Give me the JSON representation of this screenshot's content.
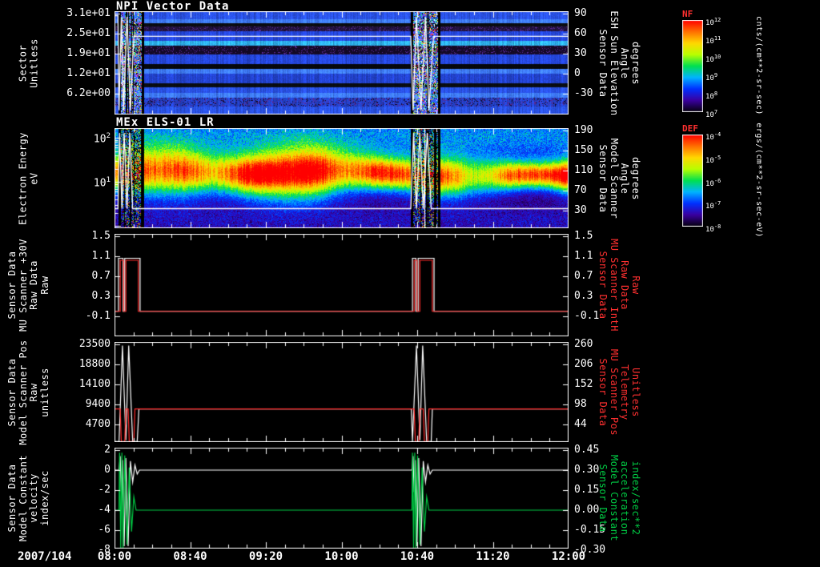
{
  "figure": {
    "background": "#000000",
    "date_label": "2007/104",
    "x_axis": {
      "tick_labels": [
        "08:00",
        "08:40",
        "09:20",
        "10:00",
        "10:40",
        "11:20",
        "12:00"
      ],
      "start_hour": 8.0,
      "end_hour": 12.0,
      "minor_tick_minutes": 10
    },
    "event_windows_hours": [
      [
        8.04,
        8.25
      ],
      [
        10.62,
        10.86
      ]
    ]
  },
  "colors": {
    "axis": "#ffffff",
    "red_series": "#ff2a2a",
    "green_series": "#00cc44",
    "white_series": "#ffffff",
    "colorbar_title": "#ff3030"
  },
  "chart_data": [
    {
      "type": "heatmap",
      "title": "NPI Vector Data",
      "left_axis": {
        "label_lines": [
          "Sector",
          "Unitless"
        ],
        "tick_labels": [
          "3.1e+01",
          "2.5e+01",
          "1.9e+01",
          "1.2e+01",
          "6.2e+00"
        ],
        "color": "#ffffff"
      },
      "right_axis": {
        "label_lines": [
          "Sensor Data",
          "ESH Sun Elevation",
          "Angle",
          "degrees"
        ],
        "tick_labels": [
          "90",
          "60",
          "30",
          "0",
          "-30"
        ],
        "top_tick_value": 90,
        "tick_step": -30,
        "color": "#ffffff"
      },
      "colorbar": {
        "title": "NF",
        "units": "cnts/(cm**2-sr-sec)",
        "tick_base": "10",
        "tick_exponents": [
          "12",
          "11",
          "10",
          "9",
          "8",
          "7"
        ]
      },
      "band_rows": [
        [
          10,
          "#2a52e8",
          0
        ],
        [
          5,
          "#3f7cff",
          0
        ],
        [
          4,
          "#0a0d12",
          0
        ],
        [
          6,
          "#241440",
          1
        ],
        [
          12,
          "#2547dd",
          0
        ],
        [
          6,
          "#2fb3f2",
          0
        ],
        [
          11,
          "#150a28",
          1
        ],
        [
          12,
          "#2547dd",
          0
        ],
        [
          6,
          "#06080c",
          0
        ],
        [
          6,
          "#3f7cff",
          0
        ],
        [
          12,
          "#2343cf",
          0
        ],
        [
          5,
          "#0a0d12",
          0
        ],
        [
          7,
          "#2a52e8",
          0
        ],
        [
          6,
          "#3f7cff",
          0
        ],
        [
          11,
          "#2343cf",
          1
        ],
        [
          10,
          "#2a52e8",
          0
        ]
      ],
      "noise_palette": [
        "#3355ff",
        "#22ccff",
        "#000000",
        "#ff3333",
        "#ffee00",
        "#33ff66",
        "#cc44ff",
        "#000000",
        "#3355ff",
        "#ffffff"
      ],
      "overlay_trace": {
        "name": "ESH Sun Elevation Angle",
        "color": "#ffffff",
        "axis": "right",
        "points": [
          [
            8.0,
            87
          ],
          [
            8.03,
            87
          ],
          [
            8.04,
            -55
          ],
          [
            8.06,
            85
          ],
          [
            8.08,
            -55
          ],
          [
            8.11,
            85
          ],
          [
            8.14,
            -55
          ],
          [
            8.17,
            56
          ],
          [
            10.61,
            56
          ],
          [
            10.63,
            -55
          ],
          [
            10.66,
            85
          ],
          [
            10.7,
            -55
          ],
          [
            10.74,
            85
          ],
          [
            10.77,
            -55
          ],
          [
            10.81,
            56
          ],
          [
            12.0,
            56
          ]
        ]
      }
    },
    {
      "type": "heatmap",
      "title": "MEx ELS-01 LR",
      "left_axis": {
        "label_lines": [
          "Electron Energy",
          "eV"
        ],
        "log": true,
        "decade_exponents": [
          "2",
          "1"
        ],
        "log_top": 2.217,
        "log_bottom": -0.046,
        "color": "#ffffff"
      },
      "right_axis": {
        "label_lines": [
          "Sensor Data",
          "Model Scanner",
          "Angle",
          "degrees"
        ],
        "tick_labels": [
          "190",
          "150",
          "110",
          "70",
          "30"
        ],
        "top_tick_value": 190,
        "tick_step": -40,
        "color": "#ffffff"
      },
      "colorbar": {
        "title": "DEF",
        "units": "ergs/(cm**2-sr-sec-eV)",
        "tick_base": "10",
        "tick_exponents": [
          "-4",
          "-5",
          "-6",
          "-7",
          "-8"
        ]
      },
      "spectrum": {
        "center_log_ev": 1.15,
        "sigma_log": 0.3,
        "peak_amp": 1.0,
        "haze_center_log": 2.05,
        "haze_amp": 0.3,
        "bottom_haze_center_log": 0.15,
        "bottom_haze_amp": 0.12
      },
      "colormap": [
        "#05000d",
        "#3a00a0",
        "#0030ff",
        "#00b4ff",
        "#00e050",
        "#b8ff00",
        "#ffd800",
        "#ff7000",
        "#ff0000"
      ],
      "overlay_trace": {
        "name": "Model Scanner Angle",
        "color": "#ffffff",
        "axis": "right",
        "points": [
          [
            8.0,
            34
          ],
          [
            8.03,
            34
          ],
          [
            8.045,
            185
          ],
          [
            8.065,
            34
          ],
          [
            8.085,
            185
          ],
          [
            8.11,
            34
          ],
          [
            8.135,
            185
          ],
          [
            8.16,
            34
          ],
          [
            10.61,
            34
          ],
          [
            10.635,
            185
          ],
          [
            10.66,
            34
          ],
          [
            10.69,
            185
          ],
          [
            10.72,
            34
          ],
          [
            10.755,
            185
          ],
          [
            10.79,
            34
          ],
          [
            12.0,
            34
          ]
        ]
      }
    },
    {
      "type": "line",
      "left_axis": {
        "label_lines": [
          "Sensor Data",
          "MU Scanner +30V",
          "Raw Data",
          "Raw"
        ],
        "tick_labels": [
          "1.5",
          "1.1",
          "0.7",
          "0.3",
          "-0.1"
        ],
        "top_tick_value": 1.5,
        "tick_step": -0.4,
        "color": "#ffffff"
      },
      "right_axis": {
        "label_lines": [
          "Sensor Data",
          "MU Scanner IntH",
          "Raw Data",
          "Raw"
        ],
        "tick_labels": [
          "1.5",
          "1.1",
          "0.7",
          "0.3",
          "-0.1"
        ],
        "top_tick_value": 1.5,
        "tick_step": -0.4,
        "color": "#ff3030"
      },
      "series": [
        {
          "name": "MU Scanner +30V Raw",
          "color": "#ffffff",
          "axis": "left",
          "points": [
            [
              8.0,
              0
            ],
            [
              8.035,
              0
            ],
            [
              8.035,
              1.06
            ],
            [
              8.075,
              1.06
            ],
            [
              8.075,
              0
            ],
            [
              8.09,
              0
            ],
            [
              8.09,
              1.06
            ],
            [
              8.225,
              1.06
            ],
            [
              8.225,
              0
            ],
            [
              10.625,
              0
            ],
            [
              10.625,
              1.06
            ],
            [
              10.655,
              1.06
            ],
            [
              10.655,
              0
            ],
            [
              10.675,
              0
            ],
            [
              10.675,
              1.06
            ],
            [
              10.815,
              1.06
            ],
            [
              10.815,
              0
            ],
            [
              12.0,
              0
            ]
          ]
        },
        {
          "name": "MU Scanner IntH Raw",
          "color": "#ff2a2a",
          "axis": "left",
          "points": [
            [
              8.0,
              0
            ],
            [
              8.05,
              0
            ],
            [
              8.05,
              1.02
            ],
            [
              8.08,
              1.02
            ],
            [
              8.08,
              0
            ],
            [
              8.1,
              0
            ],
            [
              8.1,
              1.02
            ],
            [
              8.21,
              1.02
            ],
            [
              8.21,
              0
            ],
            [
              10.64,
              0
            ],
            [
              10.64,
              1.02
            ],
            [
              10.665,
              1.02
            ],
            [
              10.665,
              0
            ],
            [
              10.69,
              0
            ],
            [
              10.69,
              1.02
            ],
            [
              10.8,
              1.02
            ],
            [
              10.8,
              0
            ],
            [
              12.0,
              0
            ]
          ]
        }
      ]
    },
    {
      "type": "line",
      "left_axis": {
        "label_lines": [
          "Sensor Data",
          "Model Scanner Pos",
          "Raw",
          "unitless"
        ],
        "tick_labels": [
          "23500",
          "18800",
          "14100",
          "9400",
          "4700"
        ],
        "top_tick_value": 23500,
        "tick_step": -4700,
        "color": "#ffffff"
      },
      "right_axis": {
        "label_lines": [
          "Sensor Data",
          "MU Scanner Pos",
          "Telemetry",
          "Unitless"
        ],
        "tick_labels": [
          "260",
          "206",
          "152",
          "98",
          "44"
        ],
        "top_tick_value": 260,
        "tick_step": -54,
        "color": "#ff3030"
      },
      "series": [
        {
          "name": "Model Scanner Pos Raw",
          "color": "#ffffff",
          "axis": "left",
          "points": [
            [
              8.0,
              700
            ],
            [
              8.04,
              700
            ],
            [
              8.07,
              23200
            ],
            [
              8.1,
              1000
            ],
            [
              8.125,
              23200
            ],
            [
              8.16,
              700
            ],
            [
              8.2,
              700
            ],
            [
              8.215,
              8350
            ],
            [
              10.615,
              8350
            ],
            [
              10.625,
              700
            ],
            [
              10.66,
              23200
            ],
            [
              10.69,
              1000
            ],
            [
              10.715,
              23200
            ],
            [
              10.75,
              700
            ],
            [
              10.79,
              700
            ],
            [
              10.8,
              8350
            ],
            [
              12.0,
              8350
            ]
          ]
        },
        {
          "name": "MU Scanner Pos Telemetry",
          "color": "#ff2a2a",
          "axis": "left",
          "points": [
            [
              8.0,
              8350
            ],
            [
              8.05,
              8350
            ],
            [
              8.06,
              600
            ],
            [
              8.09,
              600
            ],
            [
              8.1,
              8350
            ],
            [
              8.12,
              8350
            ],
            [
              8.13,
              600
            ],
            [
              8.17,
              600
            ],
            [
              8.18,
              8350
            ],
            [
              10.64,
              8350
            ],
            [
              10.65,
              600
            ],
            [
              10.68,
              600
            ],
            [
              10.69,
              8350
            ],
            [
              10.72,
              8350
            ],
            [
              10.73,
              600
            ],
            [
              10.76,
              600
            ],
            [
              10.77,
              8350
            ],
            [
              12.0,
              8350
            ]
          ]
        }
      ]
    },
    {
      "type": "line",
      "left_axis": {
        "label_lines": [
          "Sensor Data",
          "Model Constant",
          "velocity",
          "index/sec"
        ],
        "tick_labels": [
          "2",
          "0",
          "-2",
          "-4",
          "-6",
          "-8"
        ],
        "top_tick_value": 2,
        "tick_step": -2,
        "color": "#ffffff"
      },
      "right_axis": {
        "label_lines": [
          "Sensor Data",
          "Model Constant",
          "acceleration",
          "index/sec**2"
        ],
        "tick_labels": [
          "0.45",
          "0.30",
          "0.15",
          "0.00",
          "-0.15",
          "-0.30"
        ],
        "top_tick_value": 0.45,
        "tick_step": -0.15,
        "color": "#00cc44"
      },
      "series": [
        {
          "name": "Model Constant velocity",
          "color": "#ffffff",
          "axis": "left",
          "points": [
            [
              8.0,
              0
            ],
            [
              8.04,
              0
            ],
            [
              8.05,
              1.4
            ],
            [
              8.06,
              -2.2
            ],
            [
              8.07,
              1.0
            ],
            [
              8.085,
              -7.6
            ],
            [
              8.1,
              1.2
            ],
            [
              8.12,
              -7.6
            ],
            [
              8.14,
              0.9
            ],
            [
              8.16,
              -1.2
            ],
            [
              8.18,
              0.5
            ],
            [
              8.2,
              -0.4
            ],
            [
              8.22,
              0
            ],
            [
              10.62,
              0
            ],
            [
              10.63,
              1.4
            ],
            [
              10.64,
              -2.2
            ],
            [
              10.65,
              1.0
            ],
            [
              10.665,
              -7.6
            ],
            [
              10.68,
              1.2
            ],
            [
              10.7,
              -7.6
            ],
            [
              10.72,
              0.9
            ],
            [
              10.74,
              -1.2
            ],
            [
              10.76,
              0.5
            ],
            [
              10.78,
              -0.4
            ],
            [
              10.8,
              0
            ],
            [
              12.0,
              0
            ]
          ]
        },
        {
          "name": "Model Constant acceleration",
          "color": "#00cc44",
          "axis": "right",
          "points": [
            [
              8.0,
              0
            ],
            [
              8.04,
              0
            ],
            [
              8.045,
              0.43
            ],
            [
              8.055,
              -0.29
            ],
            [
              8.065,
              0.43
            ],
            [
              8.075,
              -0.29
            ],
            [
              8.09,
              0.41
            ],
            [
              8.11,
              -0.26
            ],
            [
              8.13,
              0.32
            ],
            [
              8.15,
              -0.16
            ],
            [
              8.17,
              0.1
            ],
            [
              8.19,
              0
            ],
            [
              10.62,
              0
            ],
            [
              10.625,
              0.43
            ],
            [
              10.635,
              -0.29
            ],
            [
              10.645,
              0.43
            ],
            [
              10.655,
              -0.29
            ],
            [
              10.67,
              0.41
            ],
            [
              10.69,
              -0.26
            ],
            [
              10.71,
              0.32
            ],
            [
              10.73,
              -0.16
            ],
            [
              10.75,
              0.1
            ],
            [
              10.77,
              0
            ],
            [
              12.0,
              0
            ]
          ]
        }
      ]
    }
  ]
}
